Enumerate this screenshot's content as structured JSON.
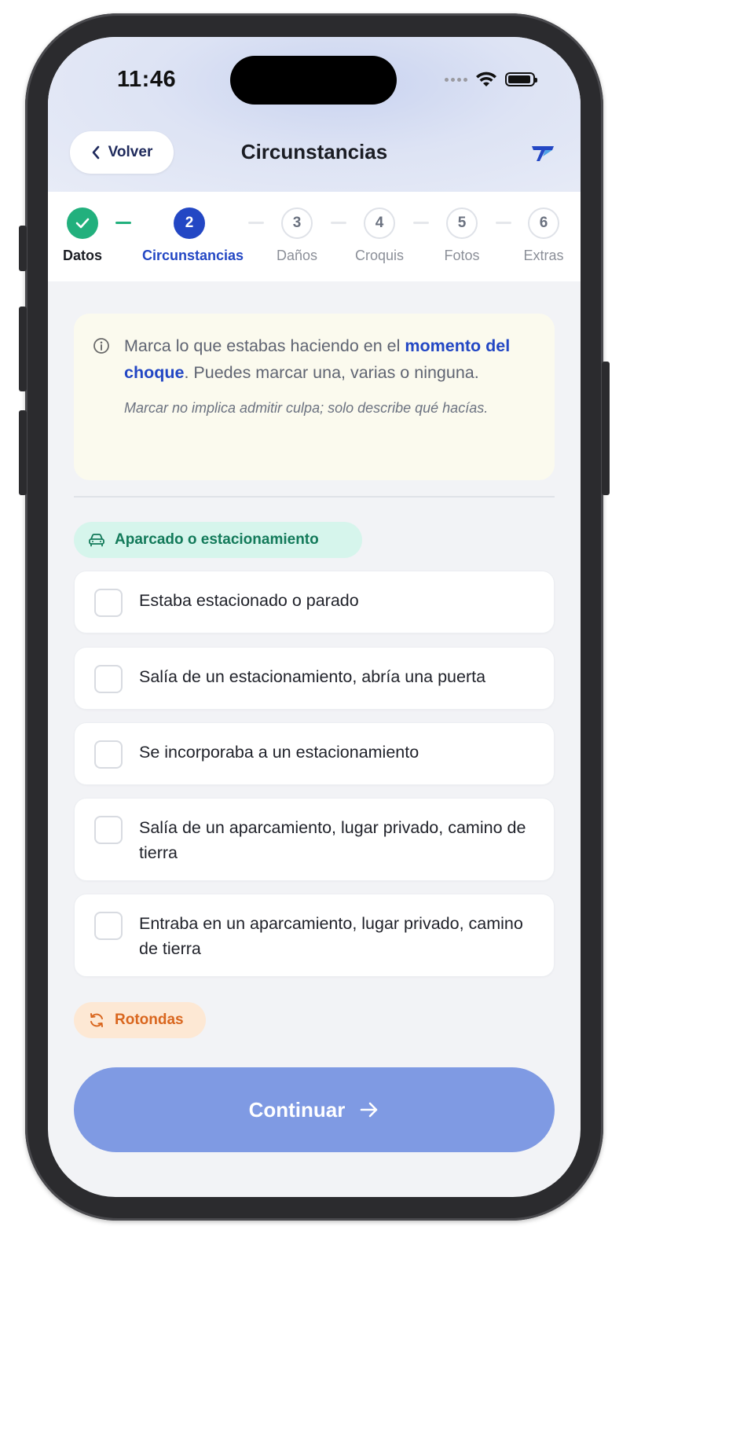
{
  "status_bar": {
    "time": "11:46"
  },
  "header": {
    "back_label": "Volver",
    "title": "Circunstancias"
  },
  "stepper": {
    "steps": [
      {
        "number": "1",
        "label": "Datos",
        "state": "done"
      },
      {
        "number": "2",
        "label": "Circunstancias",
        "state": "active"
      },
      {
        "number": "3",
        "label": "Daños",
        "state": "pending"
      },
      {
        "number": "4",
        "label": "Croquis",
        "state": "pending"
      },
      {
        "number": "5",
        "label": "Fotos",
        "state": "pending"
      },
      {
        "number": "6",
        "label": "Extras",
        "state": "pending"
      }
    ]
  },
  "info": {
    "text_before": "Marca lo que estabas haciendo en el ",
    "text_bold": "momento del choque",
    "text_after": ". Puedes marcar una, varias o ninguna.",
    "note": "Marcar no implica admitir culpa; solo describe qué hacías."
  },
  "sections": [
    {
      "title": "Aparcado o estacionamiento",
      "icon": "car-icon",
      "color": "#137a5a",
      "options": [
        {
          "label": "Estaba estacionado o parado",
          "checked": false
        },
        {
          "label": "Salía de un estacionamiento, abría una puerta",
          "checked": false
        },
        {
          "label": "Se incorporaba a un estacionamiento",
          "checked": false
        },
        {
          "label": "Salía de un aparcamiento, lugar privado, camino de tierra",
          "checked": false
        },
        {
          "label": "Entraba en un aparcamiento, lugar privado, camino de tierra",
          "checked": false
        }
      ]
    },
    {
      "title": "Rotondas",
      "icon": "refresh-icon",
      "color": "#d9661e"
    }
  ],
  "footer": {
    "continue_label": "Continuar"
  },
  "colors": {
    "primary": "#2347c4",
    "success": "#22b07d",
    "continue_disabled": "#7f9ae3",
    "info_bg": "#fbfaee"
  }
}
